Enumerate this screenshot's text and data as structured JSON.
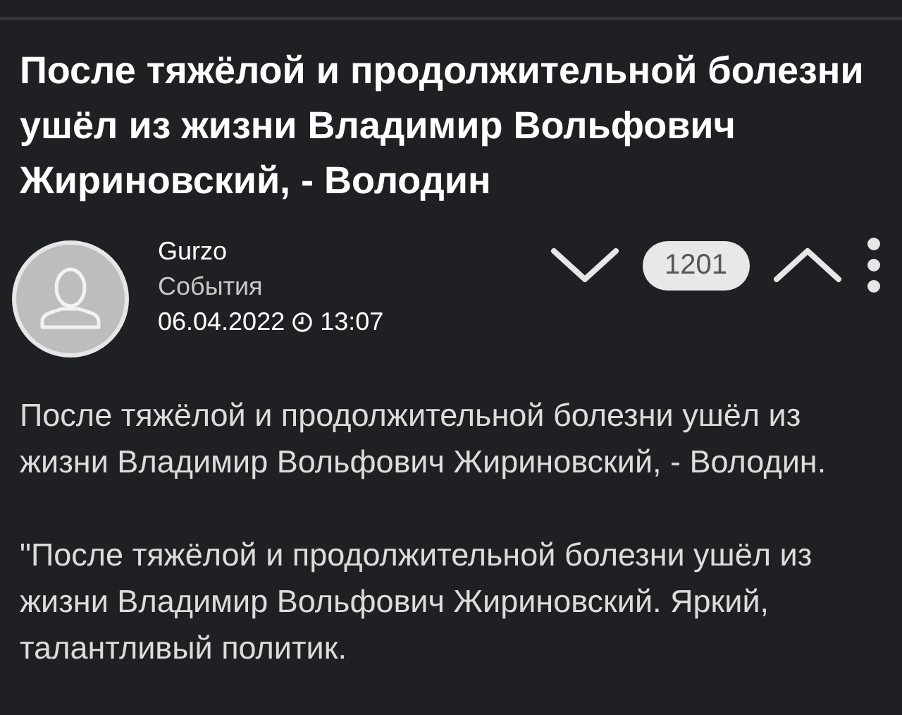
{
  "title": "После тяжёлой и продолжительной болезни ушёл из жизни Владимир Вольфович Жириновский, - Володин",
  "author": {
    "name": "Gurzo",
    "category": "События",
    "date": "06.04.2022",
    "time": "13:07"
  },
  "rating": {
    "count": "1201"
  },
  "body": [
    "После тяжёлой и продолжительной болезни ушёл из жизни Владимир Вольфович Жириновский, - Володин.",
    "\"После тяжёлой и продолжительной болезни ушёл из жизни Владимир Вольфович Жириновский. Яркий, талантливый политик."
  ]
}
